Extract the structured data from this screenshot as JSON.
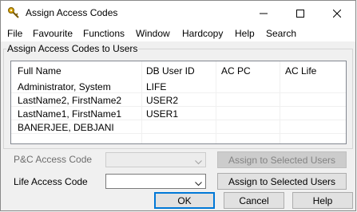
{
  "window": {
    "title": "Assign Access Codes"
  },
  "menu": [
    "File",
    "Favourite",
    "Functions",
    "Window",
    "Hardcopy",
    "Help",
    "Search"
  ],
  "group_title": "Assign Access Codes to Users",
  "table": {
    "headers": [
      "Full Name",
      "DB User ID",
      "AC PC",
      "AC Life"
    ],
    "rows": [
      [
        "Administrator, System",
        "LIFE",
        "",
        ""
      ],
      [
        "LastName2, FirstName2",
        "USER2",
        "",
        ""
      ],
      [
        "LastName1, FirstName1",
        "USER1",
        "",
        ""
      ],
      [
        "BANERJEE, DEBJANI",
        "",
        "",
        ""
      ]
    ]
  },
  "pc_access": {
    "label": "P&C Access Code",
    "value": "",
    "button": "Assign to Selected Users",
    "enabled": false
  },
  "life_access": {
    "label": "Life  Access Code",
    "value": "",
    "button": "Assign to Selected Users",
    "enabled": true
  },
  "footer": {
    "ok": "OK",
    "cancel": "Cancel",
    "help": "Help"
  },
  "colors": {
    "default_button_border": "#0078d7",
    "grid_line": "#f0f0f0"
  }
}
